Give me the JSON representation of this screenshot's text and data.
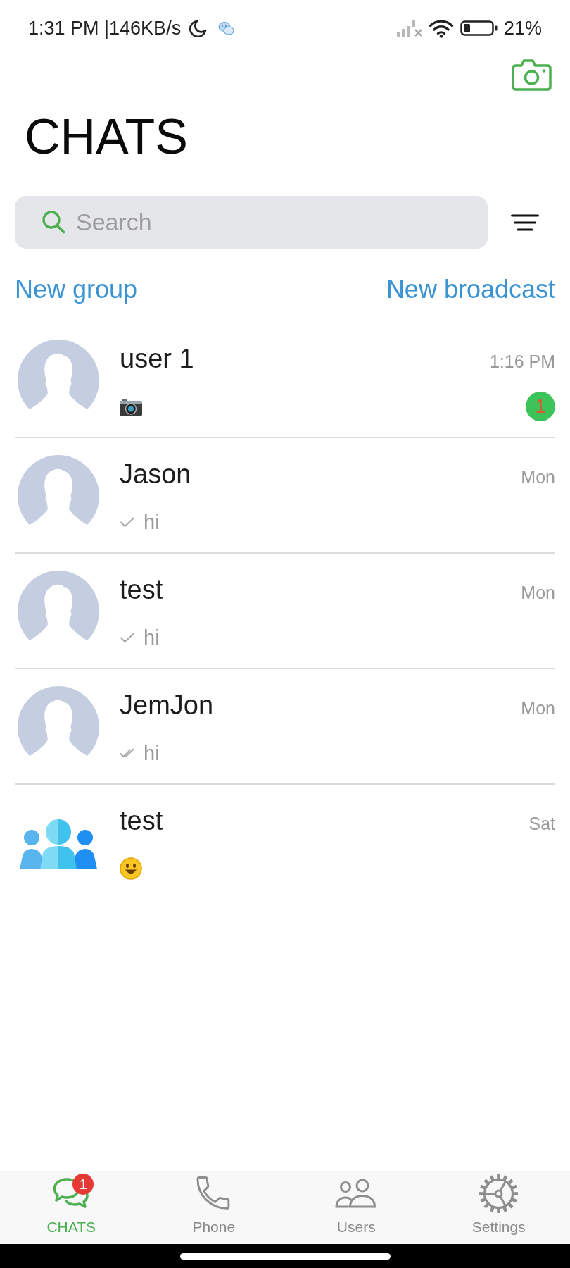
{
  "status_bar": {
    "time": "1:31 PM |146KB/s",
    "battery": "21%"
  },
  "header": {
    "title": "CHATS"
  },
  "search": {
    "placeholder": "Search"
  },
  "actions": [
    "New group",
    "New broadcast"
  ],
  "chats": [
    {
      "kind": "person",
      "name": "user 1",
      "time": "1:16 PM",
      "preview": {
        "kind": "photo"
      },
      "unread": "1"
    },
    {
      "kind": "person",
      "name": "Jason",
      "time": "Mon",
      "preview": {
        "kind": "text",
        "text": "hi",
        "delivered": false
      }
    },
    {
      "kind": "person",
      "name": "test",
      "time": "Mon",
      "preview": {
        "kind": "text",
        "text": "hi",
        "delivered": false
      }
    },
    {
      "kind": "person",
      "name": "JemJon",
      "time": "Mon",
      "preview": {
        "kind": "text",
        "text": "hi",
        "delivered": true
      }
    },
    {
      "kind": "group",
      "name": "test",
      "time": "Sat",
      "preview": {
        "kind": "smiley"
      }
    }
  ],
  "tab_bar": [
    {
      "label": "CHATS",
      "selected": true,
      "badge": "1"
    },
    {
      "label": "Phone",
      "selected": false
    },
    {
      "label": "Users",
      "selected": false
    },
    {
      "label": "Settings",
      "selected": false
    }
  ]
}
